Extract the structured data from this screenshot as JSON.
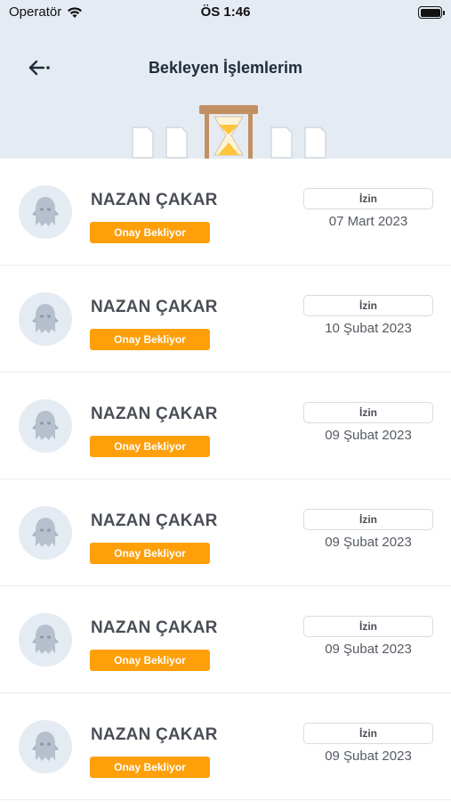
{
  "status_bar": {
    "carrier": "Operatör",
    "time": "ÖS 1:46"
  },
  "header": {
    "title": "Bekleyen İşlemlerim",
    "back_icon": "back-arrow-icon"
  },
  "requests": [
    {
      "name": "NAZAN ÇAKAR",
      "status": "Onay Bekliyor",
      "type": "İzin",
      "date": "07 Mart 2023"
    },
    {
      "name": "NAZAN ÇAKAR",
      "status": "Onay Bekliyor",
      "type": "İzin",
      "date": "10 Şubat 2023"
    },
    {
      "name": "NAZAN ÇAKAR",
      "status": "Onay Bekliyor",
      "type": "İzin",
      "date": "09 Şubat 2023"
    },
    {
      "name": "NAZAN ÇAKAR",
      "status": "Onay Bekliyor",
      "type": "İzin",
      "date": "09 Şubat 2023"
    },
    {
      "name": "NAZAN ÇAKAR",
      "status": "Onay Bekliyor",
      "type": "İzin",
      "date": "09 Şubat 2023"
    },
    {
      "name": "NAZAN ÇAKAR",
      "status": "Onay Bekliyor",
      "type": "İzin",
      "date": "09 Şubat 2023"
    }
  ],
  "colors": {
    "header_bg": "#e4ebf3",
    "badge": "#ff9f0a",
    "title": "#222b3a"
  }
}
